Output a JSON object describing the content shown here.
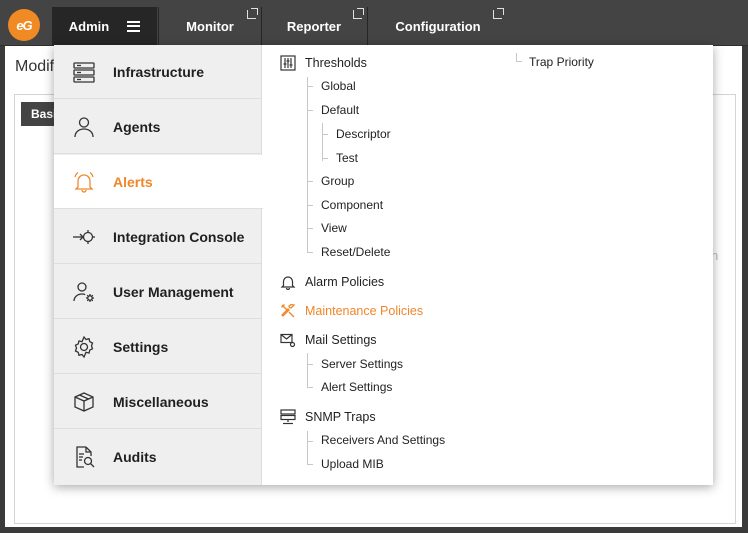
{
  "app": {
    "logo_text": "eG",
    "brand_color": "#f08a24"
  },
  "topnav": {
    "admin": "Admin",
    "monitor": "Monitor",
    "reporter": "Reporter",
    "configuration": "Configuration"
  },
  "background_page": {
    "title": "Modif",
    "tab": "Basi",
    "hint": "n"
  },
  "menu": {
    "left_items": [
      {
        "label": "Infrastructure",
        "icon": "server-icon",
        "active": false
      },
      {
        "label": "Agents",
        "icon": "user-icon",
        "active": false
      },
      {
        "label": "Alerts",
        "icon": "bell-icon",
        "active": true
      },
      {
        "label": "Integration Console",
        "icon": "integration-icon",
        "active": false
      },
      {
        "label": "User Management",
        "icon": "user-gear-icon",
        "active": false
      },
      {
        "label": "Settings",
        "icon": "gear-icon",
        "active": false
      },
      {
        "label": "Miscellaneous",
        "icon": "box-icon",
        "active": false
      },
      {
        "label": "Audits",
        "icon": "audit-icon",
        "active": false
      }
    ],
    "thresholds": {
      "label": "Thresholds",
      "global": "Global",
      "default": "Default",
      "descriptor": "Descriptor",
      "test": "Test",
      "group": "Group",
      "component": "Component",
      "view": "View",
      "reset_delete": "Reset/Delete"
    },
    "alarm_policies": "Alarm Policies",
    "maintenance_policies": "Maintenance Policies",
    "mail_settings": {
      "label": "Mail Settings",
      "server_settings": "Server Settings",
      "alert_settings": "Alert Settings"
    },
    "snmp_traps": {
      "label": "SNMP Traps",
      "receivers": "Receivers And Settings",
      "upload_mib": "Upload MIB",
      "trap_priority": "Trap Priority"
    }
  }
}
